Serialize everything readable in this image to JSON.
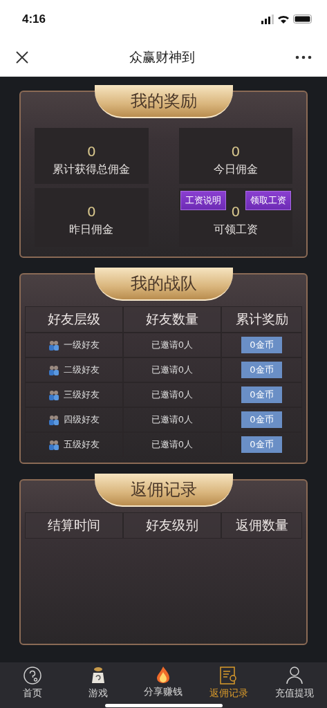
{
  "status_bar": {
    "time": "4:16"
  },
  "nav": {
    "title": "众赢财神到"
  },
  "rewards": {
    "title": "我的奖励",
    "stats": [
      {
        "value": "0",
        "label": "累计获得总佣金"
      },
      {
        "value": "0",
        "label": "今日佣金"
      },
      {
        "value": "0",
        "label": "昨日佣金"
      },
      {
        "value": "0",
        "label": "可领工资"
      }
    ],
    "salary_buttons": [
      "工资说明",
      "领取工资"
    ]
  },
  "team": {
    "title": "我的战队",
    "columns": [
      "好友层级",
      "好友数量",
      "累计奖励"
    ],
    "rows": [
      {
        "level": "一级好友",
        "count": "已邀请0人",
        "reward": "0金币"
      },
      {
        "level": "二级好友",
        "count": "已邀请0人",
        "reward": "0金币"
      },
      {
        "level": "三级好友",
        "count": "已邀请0人",
        "reward": "0金币"
      },
      {
        "level": "四级好友",
        "count": "已邀请0人",
        "reward": "0金币"
      },
      {
        "level": "五级好友",
        "count": "已邀请0人",
        "reward": "0金币"
      }
    ]
  },
  "records": {
    "title": "返佣记录",
    "columns": [
      "结算时间",
      "好友级别",
      "返佣数量"
    ]
  },
  "tab_bar": [
    {
      "label": "首页",
      "selected": false
    },
    {
      "label": "游戏",
      "selected": false
    },
    {
      "label": "分享赚钱",
      "selected": false
    },
    {
      "label": "返佣记录",
      "selected": true
    },
    {
      "label": "充值提现",
      "selected": false
    }
  ]
}
